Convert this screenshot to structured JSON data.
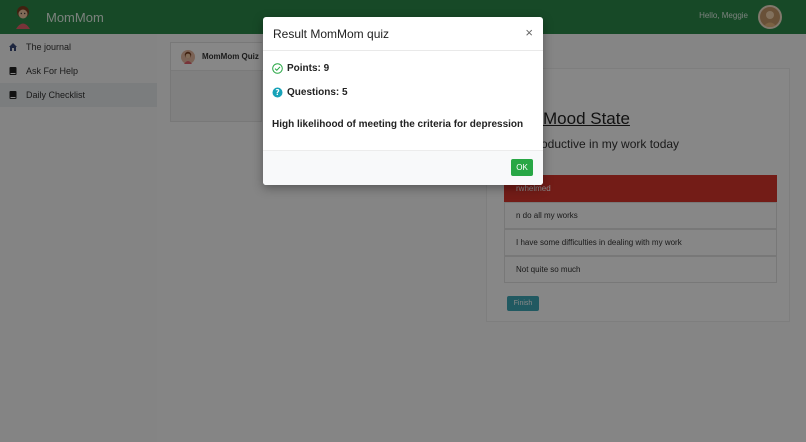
{
  "app": {
    "name": "MomMom",
    "greeting": "Hello, Meggie"
  },
  "sidebar": {
    "items": [
      {
        "label": "The journal",
        "icon": "home-icon"
      },
      {
        "label": "Ask For Help",
        "icon": "book-icon"
      },
      {
        "label": "Daily Checklist",
        "icon": "book-icon",
        "active": true
      }
    ]
  },
  "main": {
    "tab_label": "MomMom Quiz",
    "quiz": {
      "title": "Mood State",
      "question": "roductive in my work today",
      "options": [
        {
          "label": "rwhelmed",
          "selected": true
        },
        {
          "label": "n do all my works",
          "selected": false
        },
        {
          "label": "I have some difficulties in dealing with my work",
          "selected": false
        },
        {
          "label": "Not quite so much",
          "selected": false
        }
      ],
      "finish_label": "Finish"
    }
  },
  "modal": {
    "title": "Result MomMom quiz",
    "close_symbol": "×",
    "points": "Points: 9",
    "questions": "Questions: 5",
    "result": "High likelihood of meeting the criteria for depression",
    "ok_label": "OK"
  },
  "colors": {
    "navbar": "#2d8a4a",
    "selected_option": "#d9362c",
    "finish_button": "#3fa9b8",
    "ok_button": "#28a745"
  }
}
